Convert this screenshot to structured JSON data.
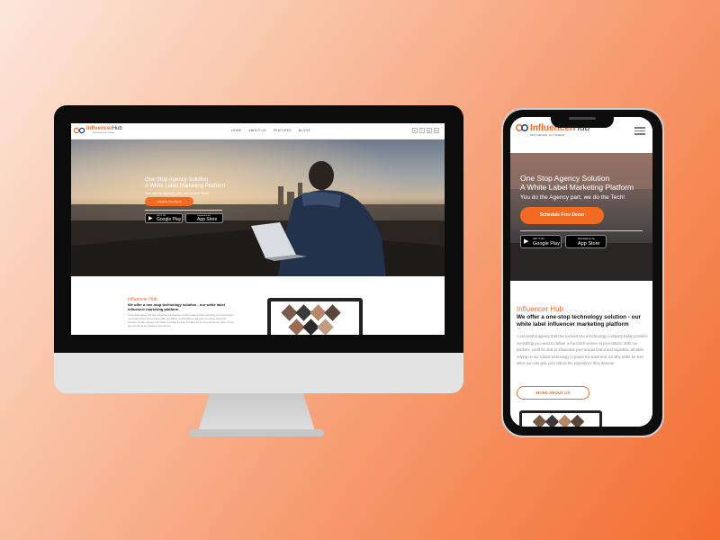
{
  "brand": {
    "name_part1": "Influencer",
    "name_part2": "Hub",
    "tagline": "INFLUENCE IS POWER",
    "accent": "#f26a21"
  },
  "nav": {
    "links": [
      "HOME",
      "ABOUT US",
      "FEATURES",
      "BLOGS"
    ],
    "social": [
      "in",
      "f",
      "ig",
      "tw"
    ]
  },
  "hero": {
    "line1": "One Stop Agency Solution",
    "line2": "A White Label Marketing Platform",
    "line3": "You do the Agency part, we do the Tech!",
    "cta": "Schedule Free Demo",
    "google_small": "GET IT ON",
    "google_big": "Google Play",
    "apple_small": "Download on the",
    "apple_big": "App Store"
  },
  "about": {
    "brand": "Influencer Hub",
    "heading": "We offer a one-stop technology solution - our white label influencer marketing platform",
    "body": "A successful agency that has evolved into a technology company today provides everything you need to deliver a top-notch service to your clients. With our platform, you'll be able to showcase your unique brand and expertise, all while relying on our robust technology to power the back-end. So why settle for less when you can give your clients the experience they deserve",
    "more_button": "MORE ABOUT US"
  }
}
